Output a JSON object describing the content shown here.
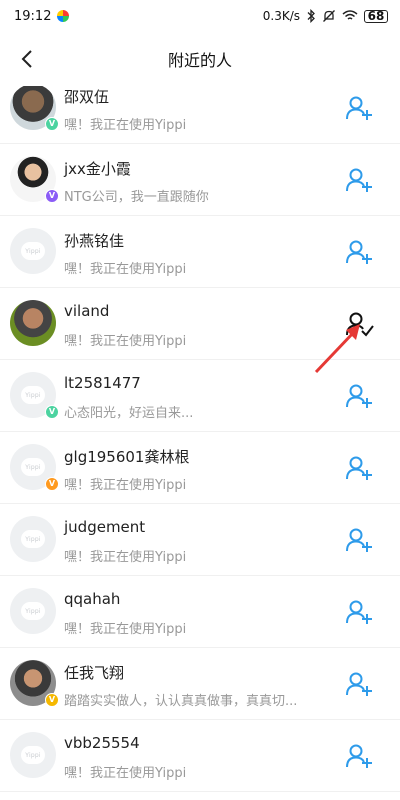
{
  "status": {
    "time": "19:12",
    "network_speed": "0.3K/s",
    "battery": "68",
    "icons": [
      "app-dot-icon",
      "bluetooth-icon",
      "mute-icon",
      "wifi-icon",
      "battery-icon"
    ]
  },
  "header": {
    "title": "附近的人"
  },
  "colors": {
    "accent": "#2e9bea",
    "badge_green": "#4cd3a0",
    "badge_purple": "#8b5cf6",
    "badge_orange": "#ff9a1f",
    "badge_yellow": "#f5b800",
    "arrow_red": "#e53935"
  },
  "users": [
    {
      "name": "邵双伍",
      "subtitle": "嘿！我正在使用Yippi",
      "badge": "green",
      "avatar": "photo",
      "action": "add-friend-icon"
    },
    {
      "name": "jxx金小霞",
      "subtitle": "NTG公司，我一直跟随你",
      "badge": "purple",
      "avatar": "photo2",
      "action": "add-friend-icon"
    },
    {
      "name": "孙燕铭佳",
      "subtitle": "嘿！我正在使用Yippi",
      "badge": "",
      "avatar": "placeholder",
      "action": "add-friend-icon"
    },
    {
      "name": "viland",
      "subtitle": "嘿！我正在使用Yippi",
      "badge": "",
      "avatar": "photo3",
      "action": "friend-added-icon"
    },
    {
      "name": "lt2581477",
      "subtitle": "心态阳光，好运自来...",
      "badge": "green",
      "avatar": "placeholder",
      "action": "add-friend-icon"
    },
    {
      "name": "glg195601龚林根",
      "subtitle": "嘿！我正在使用Yippi",
      "badge": "orange",
      "avatar": "placeholder",
      "action": "add-friend-icon"
    },
    {
      "name": "judgement",
      "subtitle": "嘿！我正在使用Yippi",
      "badge": "",
      "avatar": "placeholder",
      "action": "add-friend-icon"
    },
    {
      "name": "qqahah",
      "subtitle": "嘿！我正在使用Yippi",
      "badge": "",
      "avatar": "placeholder",
      "action": "add-friend-icon"
    },
    {
      "name": "任我飞翔",
      "subtitle": "踏踏实实做人，认认真真做事，真真切...",
      "badge": "yellow",
      "avatar": "photo4",
      "action": "add-friend-icon"
    },
    {
      "name": "vbb25554",
      "subtitle": "嘿！我正在使用Yippi",
      "badge": "",
      "avatar": "placeholder",
      "action": "add-friend-icon"
    }
  ],
  "placeholder_logo_text": "Yippi"
}
